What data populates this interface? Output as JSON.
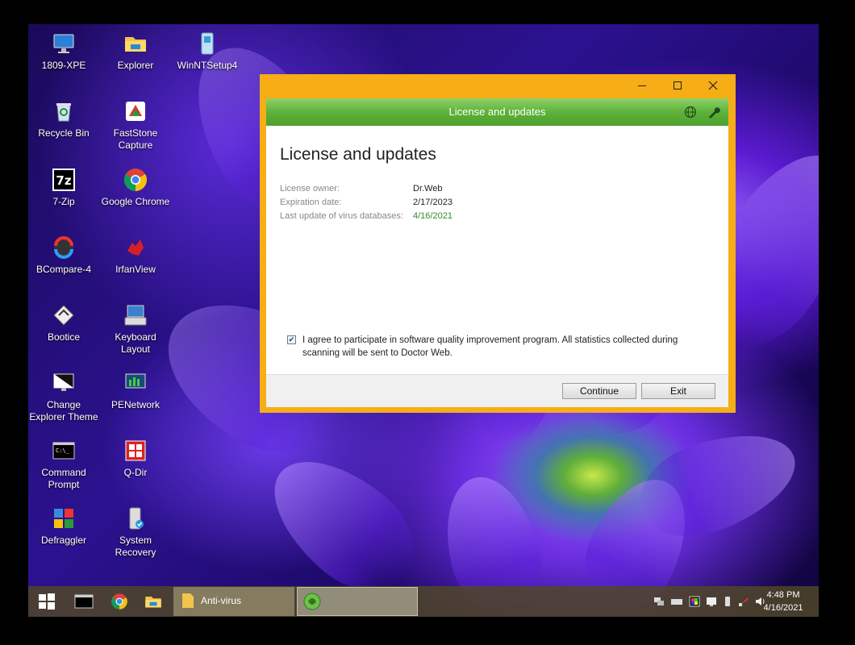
{
  "desktop": {
    "icons": [
      {
        "label": "1809-XPE",
        "icon": "monitor-icon"
      },
      {
        "label": "Explorer",
        "icon": "folder-icon"
      },
      {
        "label": "WinNTSetup4",
        "icon": "setup-icon"
      },
      {
        "label": "Recycle Bin",
        "icon": "recycle-bin-icon"
      },
      {
        "label": "FastStone Capture",
        "icon": "faststone-icon"
      },
      {
        "label": "7-Zip",
        "icon": "7zip-icon"
      },
      {
        "label": "Google Chrome",
        "icon": "chrome-icon"
      },
      {
        "label": "BCompare-4",
        "icon": "bcompare-icon"
      },
      {
        "label": "IrfanView",
        "icon": "irfanview-icon"
      },
      {
        "label": "Bootice",
        "icon": "bootice-icon"
      },
      {
        "label": "Keyboard Layout",
        "icon": "keyboard-icon"
      },
      {
        "label": "Change Explorer Theme",
        "icon": "theme-icon"
      },
      {
        "label": "PENetwork",
        "icon": "network-icon"
      },
      {
        "label": "Command Prompt",
        "icon": "cmd-icon"
      },
      {
        "label": "Q-Dir",
        "icon": "qdir-icon"
      },
      {
        "label": "Defraggler",
        "icon": "defraggler-icon"
      },
      {
        "label": "System Recovery",
        "icon": "recovery-icon"
      }
    ]
  },
  "window": {
    "title": "License and updates",
    "heading": "License and updates",
    "fields": [
      {
        "key": "License owner:",
        "value": "Dr.Web"
      },
      {
        "key": "Expiration date:",
        "value": "2/17/2023"
      },
      {
        "key": "Last update of virus databases:",
        "value": "4/16/2021"
      }
    ],
    "agree_checked": true,
    "agree_text": "I agree to participate in software quality improvement program. All statistics collected during scanning will be sent to Doctor Web.",
    "continue_label": "Continue",
    "exit_label": "Exit",
    "accent_color": "#f6ad16",
    "header_color": "#5db23a",
    "update_value_color": "#2e8b2e"
  },
  "taskbar": {
    "apps": [
      {
        "label": "Anti-virus",
        "icon": "folder-icon"
      },
      {
        "label": "",
        "icon": "drweb-icon"
      }
    ],
    "clock": {
      "time": "4:48 PM",
      "date": "4/16/2021"
    }
  }
}
